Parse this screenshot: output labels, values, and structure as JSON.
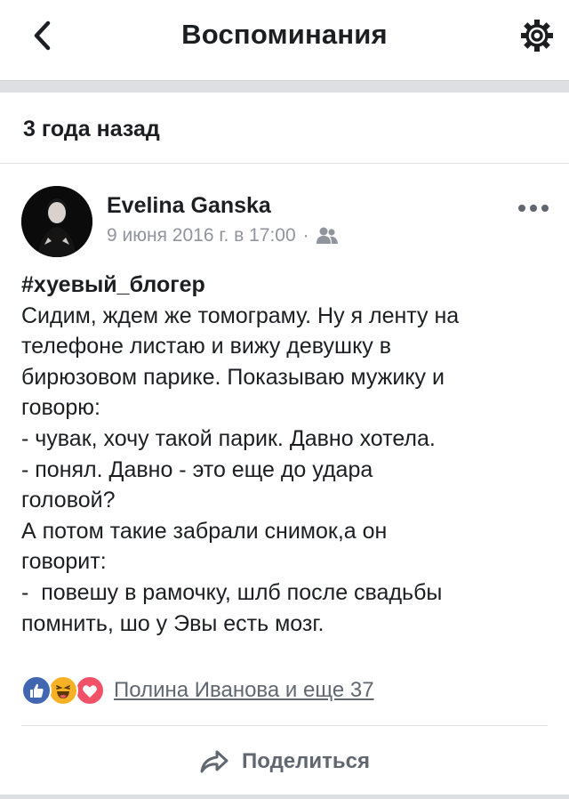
{
  "navbar": {
    "title": "Воспоминания",
    "back_icon": "chevron-left-icon",
    "settings_icon": "gear-icon"
  },
  "section": {
    "title": "3 года назад"
  },
  "post": {
    "author": "Evelina Ganska",
    "date": "9 июня 2016 г. в 17:00",
    "separator": "·",
    "audience_icon": "friends-icon",
    "more_icon": "more-dots-icon",
    "hashtag": "#хуевый_блогер",
    "lines": [
      "Сидим, ждем же томограму. Ну я ленту на",
      "телефоне листаю и вижу девушку в",
      "бирюзовом парике. Показываю мужику и",
      "говорю:",
      "- чувак, хочу такой парик. Давно хотела.",
      "- понял. Давно - это еще до удара",
      "головой?",
      "А потом такие забрали снимок,а он",
      "говорит:",
      "-  повешу в рамочку, шлб после свадьбы",
      "помнить, шо у Эвы есть мозг."
    ],
    "reactions": {
      "icons": [
        "like-icon",
        "haha-icon",
        "love-icon"
      ],
      "summary": "Полина Иванова и еще 37"
    },
    "share_label": "Поделиться",
    "share_icon": "share-arrow-icon"
  },
  "colors": {
    "text": "#1c1e21",
    "secondary": "#90949c",
    "divider": "#dddfe2",
    "like": "#4267b2",
    "haha": "#f7b125",
    "love": "#f25268"
  }
}
